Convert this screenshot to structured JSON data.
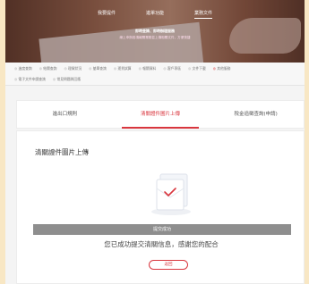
{
  "top_nav": {
    "items": [
      "我要提件",
      "進單功能",
      "業務文件"
    ],
    "active_index": 2
  },
  "hero": {
    "title": "即時查詢、即時辦理服務",
    "subtitle": "線上申辦各項報關業務並上傳相關文件，方便快捷"
  },
  "services": {
    "row1": [
      "進度查詢",
      "結關查詢",
      "理貨狀況",
      "艙單查詢",
      "運費試算",
      "報關資料",
      "客戶專區",
      "文件下載",
      "其他服務"
    ],
    "row2": [
      "電子文件申請查詢",
      "常見問題與回應"
    ]
  },
  "tabs": {
    "items": [
      "進出口規則",
      "清關證件圖片上傳",
      "稅金追徵查詢(申請)"
    ],
    "active_index": 1
  },
  "main": {
    "section_title": "清關證件圖片上傳",
    "success_bar": "提交成功",
    "success_message": "您已成功提交清關信息，感謝您的配合",
    "back_button": "返回"
  },
  "colors": {
    "accent": "#d9363e",
    "bar_gray": "#8e8e8e",
    "page_bg": "#f8e7c4"
  }
}
